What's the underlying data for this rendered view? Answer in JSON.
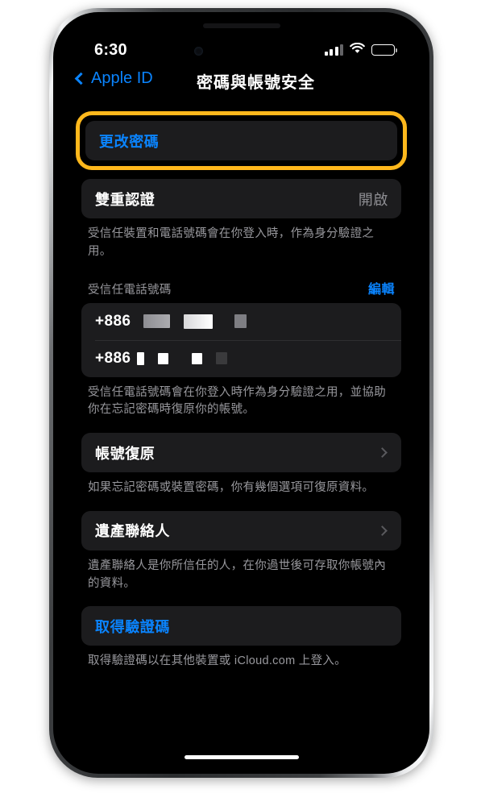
{
  "status_bar": {
    "time": "6:30",
    "signal_icon": "cellular-bars-icon",
    "wifi_icon": "wifi-icon",
    "battery_icon": "battery-full-icon"
  },
  "nav": {
    "back_label": "Apple ID",
    "back_icon": "chevron-left-icon",
    "title": "密碼與帳號安全"
  },
  "sections": {
    "change_password": {
      "label": "更改密碼",
      "highlight_color": "#ffb81c",
      "accent_color": "#0a84ff"
    },
    "two_factor": {
      "label": "雙重認證",
      "value": "開啟",
      "footer": "受信任裝置和電話號碼會在你登入時，作為身分驗證之用。"
    },
    "trusted_numbers": {
      "header": "受信任電話號碼",
      "edit_label": "編輯",
      "rows": [
        {
          "prefix": "+886"
        },
        {
          "prefix": "+886"
        }
      ],
      "footer": "受信任電話號碼會在你登入時作為身分驗證之用，並協助你在忘記密碼時復原你的帳號。"
    },
    "account_recovery": {
      "label": "帳號復原",
      "chevron_icon": "chevron-right-icon",
      "footer": "如果忘記密碼或裝置密碼，你有幾個選項可復原資料。"
    },
    "legacy_contact": {
      "label": "遺產聯絡人",
      "chevron_icon": "chevron-right-icon",
      "footer": "遺產聯絡人是你所信任的人，在你過世後可存取你帳號內的資料。"
    },
    "get_verification_code": {
      "label": "取得驗證碼",
      "footer": "取得驗證碼以在其他裝置或 iCloud.com 上登入。"
    }
  }
}
